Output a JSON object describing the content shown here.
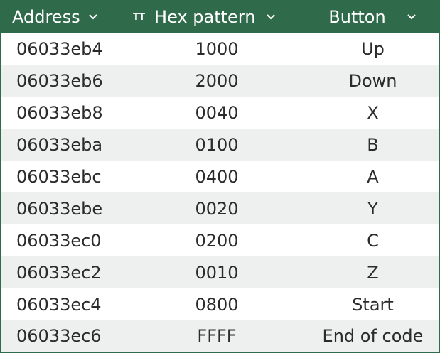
{
  "header": {
    "address_label": "Address",
    "hex_label": "Hex pattern",
    "button_label": "Button",
    "type_icon_glyph": "TT"
  },
  "rows": [
    {
      "address": "06033eb4",
      "hex": "1000",
      "button": "Up"
    },
    {
      "address": "06033eb6",
      "hex": "2000",
      "button": "Down"
    },
    {
      "address": "06033eb8",
      "hex": "0040",
      "button": "X"
    },
    {
      "address": "06033eba",
      "hex": "0100",
      "button": "B"
    },
    {
      "address": "06033ebc",
      "hex": "0400",
      "button": "A"
    },
    {
      "address": "06033ebe",
      "hex": "0020",
      "button": "Y"
    },
    {
      "address": "06033ec0",
      "hex": "0200",
      "button": "C"
    },
    {
      "address": "06033ec2",
      "hex": "0010",
      "button": "Z"
    },
    {
      "address": "06033ec4",
      "hex": "0800",
      "button": "Start"
    },
    {
      "address": "06033ec6",
      "hex": "FFFF",
      "button": "End of code"
    }
  ],
  "colors": {
    "header_bg": "#2f6b4a",
    "stripe": "#eef0ef"
  }
}
